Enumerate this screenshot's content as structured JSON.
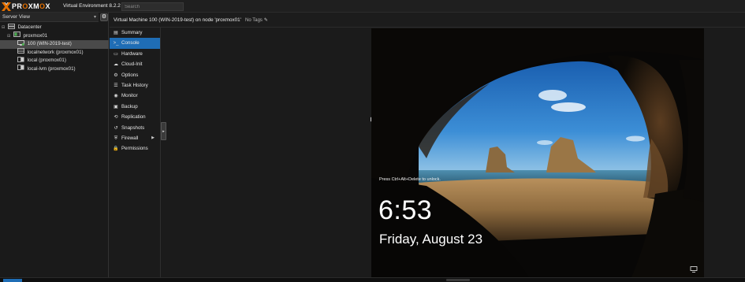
{
  "topbar": {
    "logo_text_1": "PR",
    "logo_text_o": "O",
    "logo_text_2": "XM",
    "logo_text_o2": "O",
    "logo_text_3": "X",
    "version": "Virtual Environment 8.2.2",
    "search_placeholder": "Search",
    "brand_color": "#e57000"
  },
  "left_panel": {
    "view_label": "Server View",
    "tree": [
      {
        "label": "Datacenter",
        "level": 0,
        "icon": "datacenter-icon",
        "expanded": true,
        "selected": false
      },
      {
        "label": "proxmox01",
        "level": 1,
        "icon": "node-icon",
        "expanded": true,
        "selected": false
      },
      {
        "label": "100 (WIN-2019-test)",
        "level": 2,
        "icon": "vm-running-icon",
        "selected": true
      },
      {
        "label": "localnetwork (proxmox01)",
        "level": 2,
        "icon": "network-icon",
        "selected": false
      },
      {
        "label": "local (proxmox01)",
        "level": 2,
        "icon": "storage-icon",
        "selected": false
      },
      {
        "label": "local-lvm (proxmox01)",
        "level": 2,
        "icon": "storage-icon",
        "selected": false
      }
    ]
  },
  "vm_header": {
    "title": "Virtual Machine 100 (WIN-2019-test) on node 'proxmox01'",
    "tags": "No Tags"
  },
  "vm_menu": {
    "items": [
      {
        "label": "Summary",
        "icon": "summary-icon"
      },
      {
        "label": "Console",
        "icon": "console-icon",
        "active": true
      },
      {
        "label": "Hardware",
        "icon": "hardware-icon"
      },
      {
        "label": "Cloud-Init",
        "icon": "cloud-icon"
      },
      {
        "label": "Options",
        "icon": "gear-icon"
      },
      {
        "label": "Task History",
        "icon": "task-history-icon"
      },
      {
        "label": "Monitor",
        "icon": "monitor-icon"
      },
      {
        "label": "Backup",
        "icon": "backup-icon"
      },
      {
        "label": "Replication",
        "icon": "replication-icon"
      },
      {
        "label": "Snapshots",
        "icon": "snapshots-icon"
      },
      {
        "label": "Firewall",
        "icon": "firewall-icon",
        "has_submenu": true
      },
      {
        "label": "Permissions",
        "icon": "permissions-icon"
      }
    ],
    "active_color": "#1f6db5"
  },
  "console": {
    "unlock_hint": "Press Ctrl+Alt+Delete to unlock.",
    "time": "6:53",
    "date": "Friday, August 23"
  }
}
